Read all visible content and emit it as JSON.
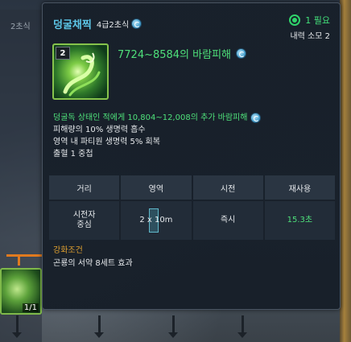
{
  "background": {
    "cost_label": "2초식",
    "skill_count": "1/1"
  },
  "tooltip": {
    "skill_name": "덩굴채찍",
    "skill_tier": "4급2초식",
    "cost_required": "1 필요",
    "cost_mp": "내력 소모 2",
    "hotkey": "2",
    "damage": "7724~8584의 바람피해",
    "desc_green": "덩굴독 상태인 적에게 10,804~12,008의 추가 바람피해",
    "desc_lines": [
      "피해량의 10% 생명력 흡수",
      "영역 내 파티원 생명력 5% 회복",
      "출혈 1 중첩"
    ],
    "stats": {
      "headers": [
        "거리",
        "영역",
        "시전",
        "재사용"
      ],
      "distance": "시전자\n중심",
      "area": "2 x 10m",
      "cast": "즉시",
      "cooldown": "15.3초"
    },
    "upgrade_title": "강화조건",
    "upgrade_desc": "곤룡의 서약 8세트 효과"
  },
  "colors": {
    "title": "#5dc7e8",
    "green": "#4ee07a",
    "upgrade": "#e0a030"
  }
}
